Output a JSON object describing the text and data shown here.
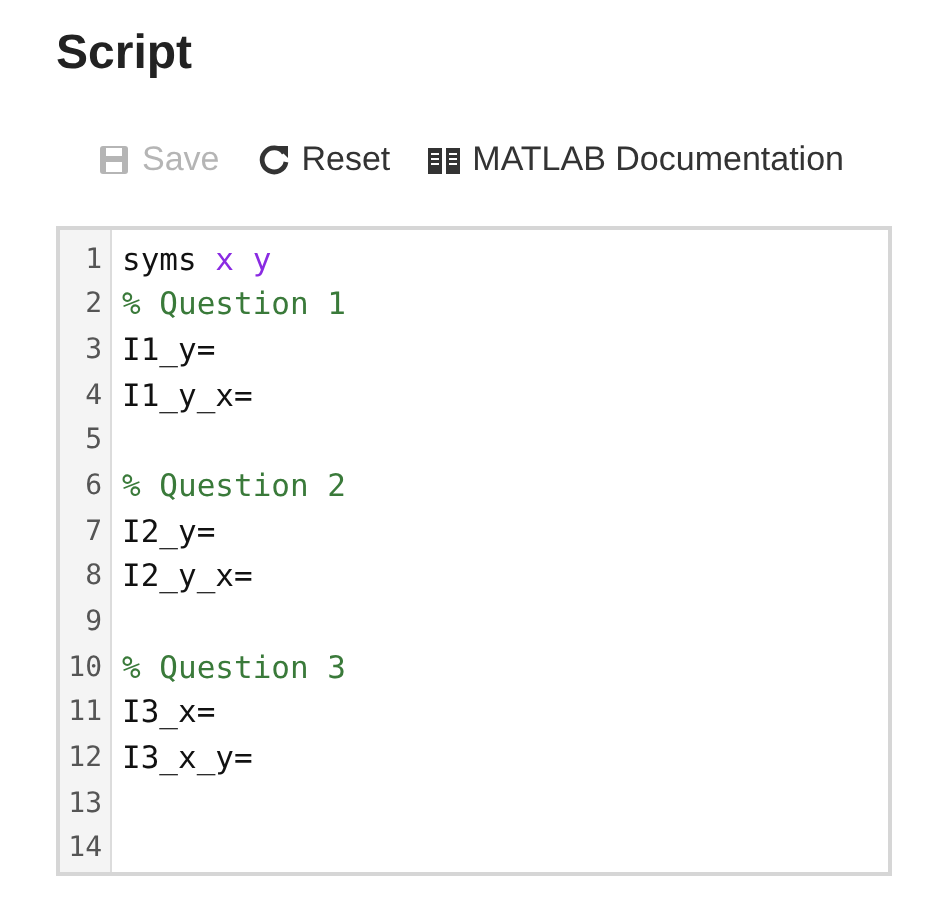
{
  "title": "Script",
  "toolbar": [
    {
      "label": "Save",
      "kind": "save",
      "disabled": true
    },
    {
      "label": "Reset",
      "kind": "reset",
      "disabled": false
    },
    {
      "label": "MATLAB Documentation",
      "kind": "book",
      "disabled": false
    }
  ],
  "editor": {
    "lines": [
      {
        "number": "1",
        "tokens": [
          {
            "kind": "plain",
            "text": "syms "
          },
          {
            "kind": "variable",
            "text": "x y"
          }
        ]
      },
      {
        "number": "2",
        "tokens": [
          {
            "kind": "comment",
            "text": "% Question 1"
          }
        ]
      },
      {
        "number": "3",
        "tokens": [
          {
            "kind": "plain",
            "text": "I1_y="
          }
        ]
      },
      {
        "number": "4",
        "tokens": [
          {
            "kind": "plain",
            "text": "I1_y_x="
          }
        ]
      },
      {
        "number": "5"
      },
      {
        "number": "6",
        "tokens": [
          {
            "kind": "comment",
            "text": "% Question 2"
          }
        ]
      },
      {
        "number": "7",
        "tokens": [
          {
            "kind": "plain",
            "text": "I2_y="
          }
        ]
      },
      {
        "number": "8",
        "tokens": [
          {
            "kind": "plain",
            "text": "I2_y_x="
          }
        ]
      },
      {
        "number": "9"
      },
      {
        "number": "10",
        "tokens": [
          {
            "kind": "comment",
            "text": "% Question 3"
          }
        ]
      },
      {
        "number": "11",
        "tokens": [
          {
            "kind": "plain",
            "text": "I3_x="
          }
        ]
      },
      {
        "number": "12",
        "tokens": [
          {
            "kind": "plain",
            "text": "I3_x_y="
          }
        ]
      },
      {
        "number": "13"
      },
      {
        "number": "14"
      }
    ]
  }
}
